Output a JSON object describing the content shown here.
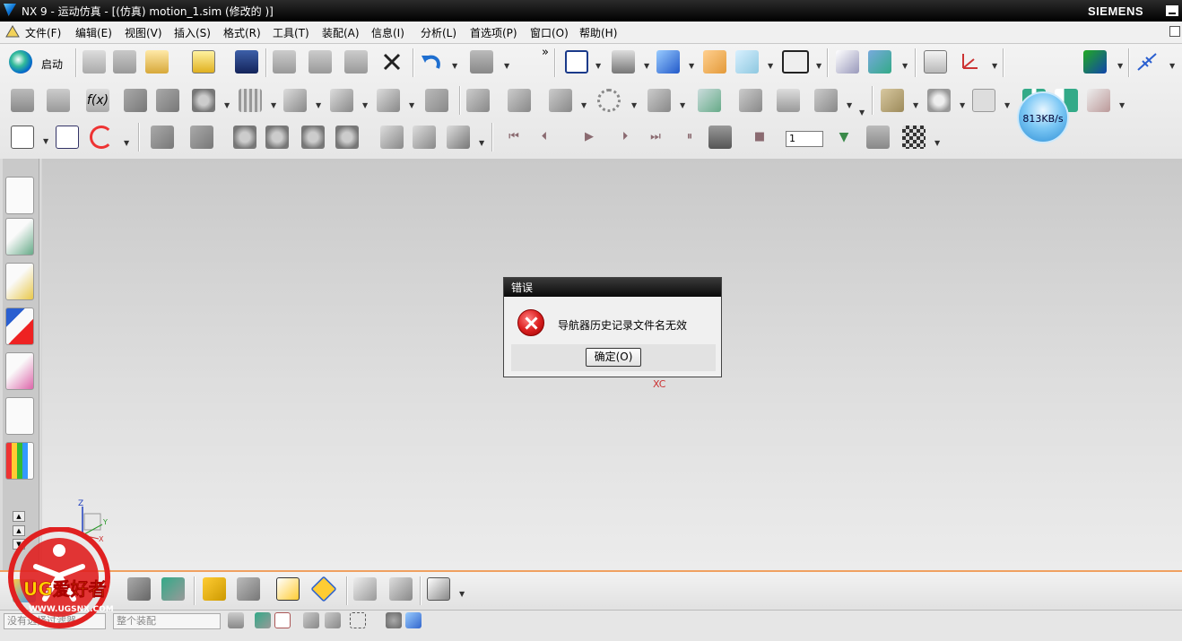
{
  "window": {
    "title": "NX 9 - 运动仿真 - [(仿真) motion_1.sim  (修改的 )]",
    "brand": "SIEMENS"
  },
  "menu": {
    "items": [
      "文件(F)",
      "编辑(E)",
      "视图(V)",
      "插入(S)",
      "格式(R)",
      "工具(T)",
      "装配(A)",
      "信息(I)",
      "分析(L)",
      "首选项(P)",
      "窗口(O)",
      "帮助(H)"
    ]
  },
  "toolbar": {
    "start_label": "启动",
    "overflow": "»",
    "frame_field": "1"
  },
  "network_widget": {
    "speed": "813KB/s"
  },
  "canvas": {
    "axis_label": "XC",
    "triad_z": "Z",
    "triad_y": "Y",
    "triad_x": "X"
  },
  "dialog": {
    "title": "错误",
    "message": "导航器历史记录文件名无效",
    "ok_label": "确定(O)"
  },
  "statusbar": {
    "filter_value": "没有选择过滤器",
    "scope_value": "整个装配"
  },
  "watermark": {
    "brand": "UG爱好者",
    "url": "WWW.UGSNX.COM"
  }
}
